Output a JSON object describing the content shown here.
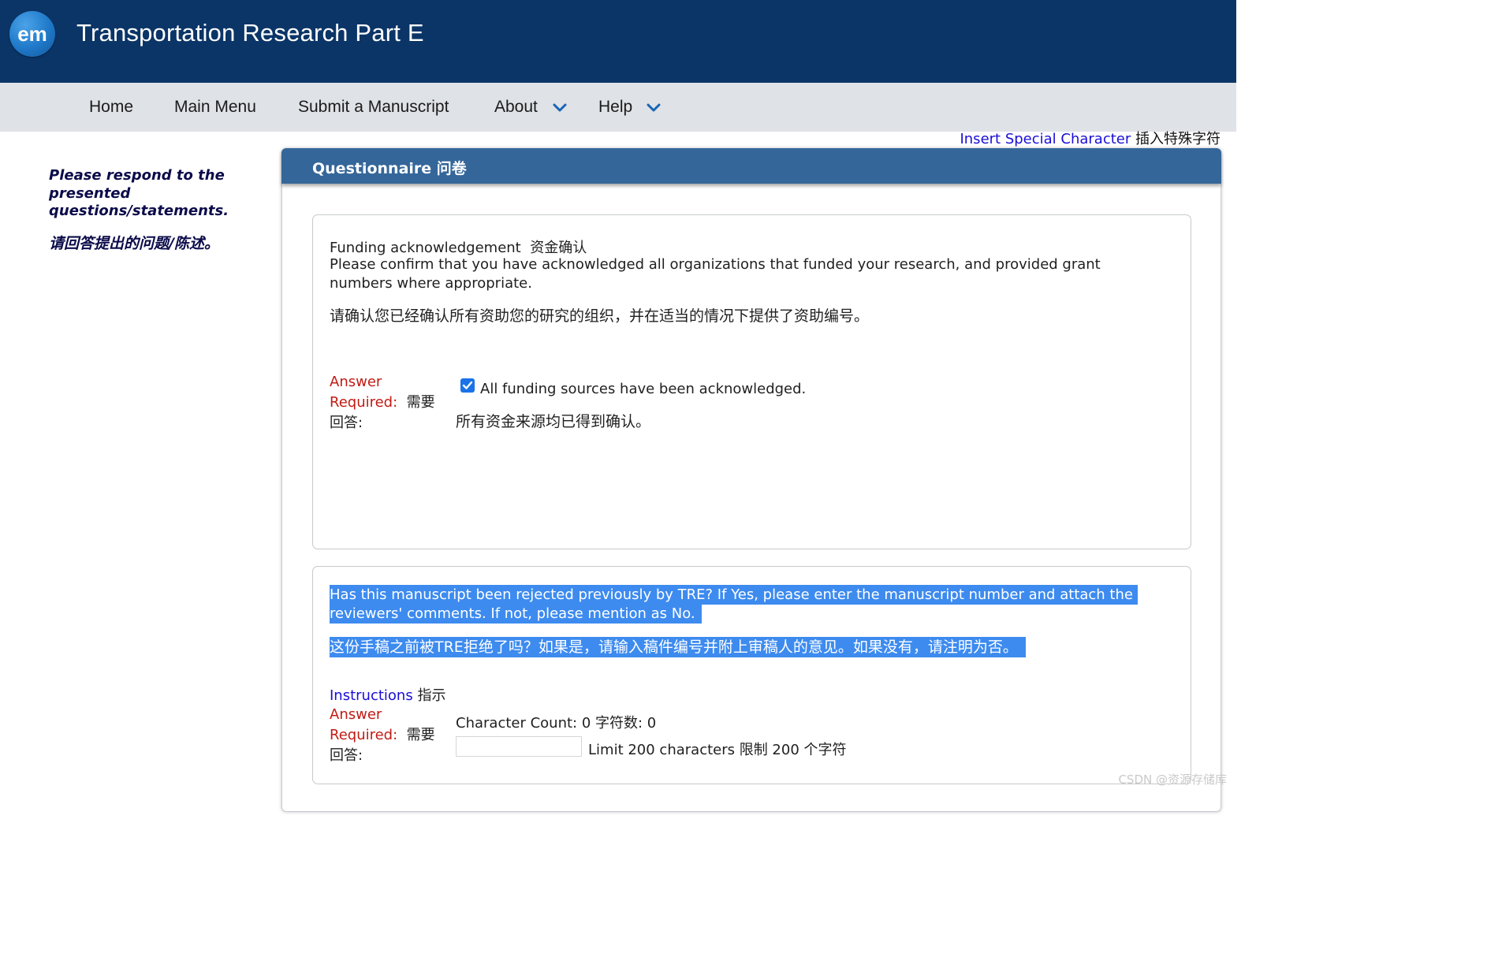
{
  "header": {
    "logo_text": "em",
    "journal_title": "Transportation Research Part E",
    "bg_color": "#0b3567"
  },
  "nav": {
    "items": [
      {
        "label": "Home"
      },
      {
        "label": "Main Menu"
      },
      {
        "label": "Submit a Manuscript"
      },
      {
        "label": "About",
        "dropdown": true
      },
      {
        "label": "Help",
        "dropdown": true
      }
    ]
  },
  "special_char": {
    "link_label": "Insert Special Character",
    "label_zh": "插入特殊字符"
  },
  "sidebar": {
    "instruction_en": "Please respond to the presented questions/statements.",
    "instruction_zh": "请回答提出的问题/陈述。"
  },
  "panel": {
    "title": "Questionnaire 问卷",
    "accent_color": "#34669a"
  },
  "questions": [
    {
      "title_en": "Funding acknowledgement",
      "title_zh": "资金确认",
      "text_en_line1": "Please confirm that you have acknowledged all organizations that funded your research, and provided grant",
      "text_en_line2": "numbers where appropriate.",
      "text_zh": "请确认您已经确认所有资助您的研究的组织，并在适当的情况下提供了资助编号。",
      "required_label_1": "Answer",
      "required_label_2": "Required:",
      "required_zh_1": "需要",
      "required_zh_2": "回答:",
      "checkbox_checked": true,
      "checkbox_label_en": "All funding sources have been acknowledged.",
      "checkbox_label_zh": "所有资金来源均已得到确认。"
    },
    {
      "text_en_line1": "Has this manuscript been rejected previously by TRE? If Yes, please enter the manuscript number and attach the",
      "text_en_line2": "reviewers' comments. If not, please mention as No.",
      "text_zh": "这份手稿之前被TRE拒绝了吗？如果是，请输入稿件编号并附上审稿人的意见。如果没有，请注明为否。",
      "instructions_label": "Instructions",
      "instructions_zh": "指示",
      "required_label_1": "Answer",
      "required_label_2": "Required:",
      "required_zh_1": "需要",
      "required_zh_2": "回答:",
      "char_count_text": "Character Count: 0 字符数: 0",
      "limit_text": "Limit 200 characters 限制 200 个字符",
      "answer_value": ""
    }
  ],
  "watermark": "CSDN @资源存储库"
}
